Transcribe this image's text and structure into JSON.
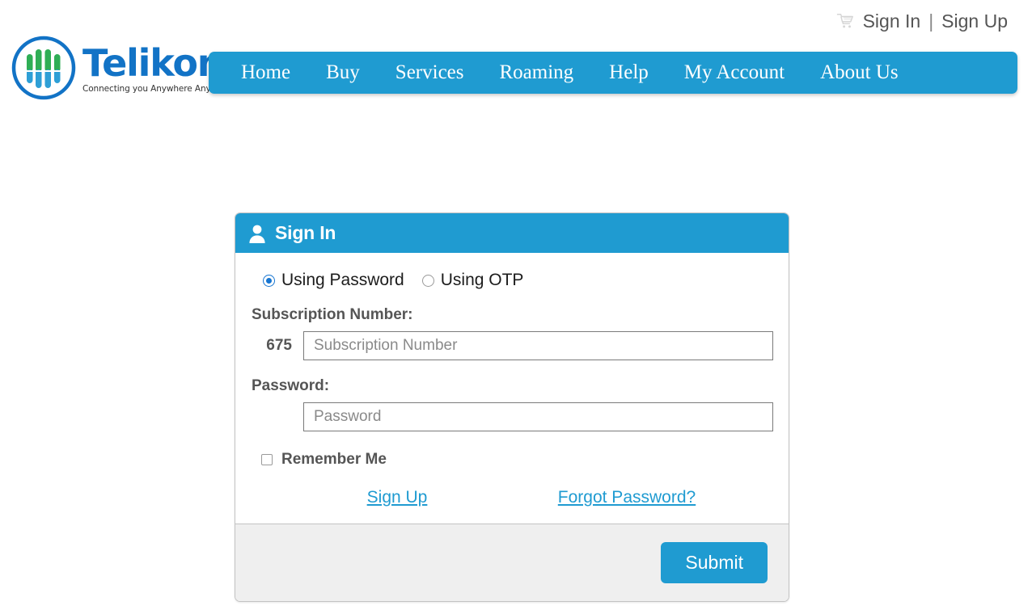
{
  "topbar": {
    "cart_icon": "shopping-cart-icon",
    "sign_in": "Sign In",
    "divider": "|",
    "sign_up": "Sign Up"
  },
  "brand": {
    "name": "Telikom",
    "tagline": "Connecting you Anywhere Anytime",
    "logo_ring_color": "#1273c6",
    "logo_bar_green": "#2fae55",
    "logo_bar_blue": "#2e9fd6",
    "wordmark_color": "#1273c6"
  },
  "nav": {
    "background_color": "#1f9bd1",
    "items": [
      {
        "label": "Home"
      },
      {
        "label": "Buy"
      },
      {
        "label": "Services"
      },
      {
        "label": "Roaming"
      },
      {
        "label": "Help"
      },
      {
        "label": "My Account"
      },
      {
        "label": "About Us"
      }
    ]
  },
  "signin_card": {
    "header_icon": "person-icon",
    "title": "Sign In",
    "header_color": "#1f9bd1",
    "method_options": [
      {
        "label": "Using Password",
        "selected": true
      },
      {
        "label": "Using OTP",
        "selected": false
      }
    ],
    "subscription": {
      "label": "Subscription Number:",
      "country_code": "675",
      "placeholder": "Subscription Number",
      "value": ""
    },
    "password": {
      "label": "Password:",
      "placeholder": "Password",
      "value": ""
    },
    "remember": {
      "label": "Remember Me",
      "checked": false
    },
    "links": {
      "sign_up": "Sign Up",
      "forgot_password": "Forgot Password?",
      "link_color": "#1f9bd1"
    },
    "footer": {
      "submit_label": "Submit",
      "background_color": "#efefef",
      "button_color": "#1f9bd1"
    }
  }
}
